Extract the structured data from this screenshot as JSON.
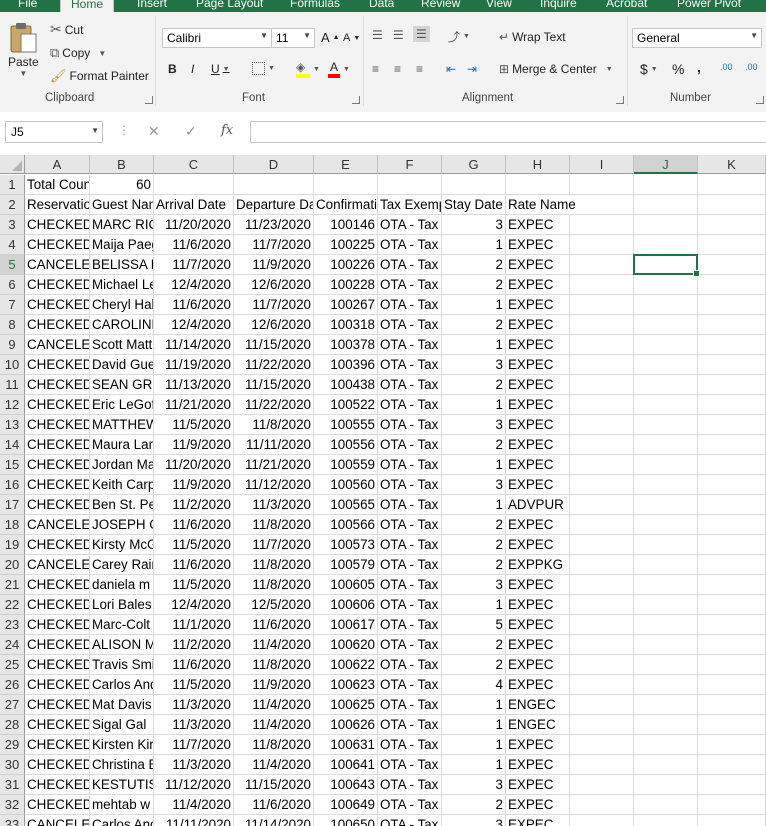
{
  "menu_tabs": [
    "File",
    "Home",
    "Insert",
    "Page Layout",
    "Formulas",
    "Data",
    "Review",
    "View",
    "Inquire",
    "Acrobat",
    "Power Pivot"
  ],
  "active_tab": "Home",
  "ribbon": {
    "clipboard": {
      "paste": "Paste",
      "cut": "Cut",
      "copy": "Copy",
      "format_painter": "Format Painter",
      "label": "Clipboard"
    },
    "font": {
      "name": "Calibri",
      "size": "11",
      "bold": "B",
      "italic": "I",
      "underline": "U",
      "grow": "A",
      "shrink": "A",
      "font_color_glyph": "A",
      "label": "Font"
    },
    "alignment": {
      "wrap_text": "Wrap Text",
      "merge_center": "Merge & Center",
      "label": "Alignment"
    },
    "number": {
      "format": "General",
      "currency": "$",
      "percent": "%",
      "comma": ",",
      "inc_decimal": ".00",
      "dec_decimal": ".00",
      "label": "Number"
    }
  },
  "formula_bar": {
    "name_box": "J5",
    "fx": "fx",
    "formula": ""
  },
  "sheet": {
    "columns": [
      "A",
      "B",
      "C",
      "D",
      "E",
      "F",
      "G",
      "H",
      "I",
      "J",
      "K"
    ],
    "selected_column": "J",
    "selected_row": 5,
    "rows": [
      {
        "n": 1,
        "A": "Total Count",
        "B": "60"
      },
      {
        "n": 2,
        "A": "ReservationStatus",
        "B": "Guest Name",
        "C": "Arrival Date",
        "D": "Departure Date",
        "E": "Confirmation",
        "F": "Tax Exempt",
        "G": "Stay Date",
        "H": "Rate Name"
      },
      {
        "n": 3,
        "A": "CHECKEDOUT",
        "B": "MARC RICH",
        "C": "11/20/2020",
        "D": "11/23/2020",
        "E": "100146",
        "F": "OTA - Tax",
        "G": "3",
        "H": "EXPEC"
      },
      {
        "n": 4,
        "A": "CHECKEDOUT",
        "B": "Maija Paeg",
        "C": "11/6/2020",
        "D": "11/7/2020",
        "E": "100225",
        "F": "OTA - Tax",
        "G": "1",
        "H": "EXPEC"
      },
      {
        "n": 5,
        "A": "CANCELED",
        "B": "BELISSA RO",
        "C": "11/7/2020",
        "D": "11/9/2020",
        "E": "100226",
        "F": "OTA - Tax",
        "G": "2",
        "H": "EXPEC"
      },
      {
        "n": 6,
        "A": "CHECKEDOUT",
        "B": "Michael Le",
        "C": "12/4/2020",
        "D": "12/6/2020",
        "E": "100228",
        "F": "OTA - Tax",
        "G": "2",
        "H": "EXPEC"
      },
      {
        "n": 7,
        "A": "CHECKEDOUT",
        "B": "Cheryl Hal",
        "C": "11/6/2020",
        "D": "11/7/2020",
        "E": "100267",
        "F": "OTA - Tax",
        "G": "1",
        "H": "EXPEC"
      },
      {
        "n": 8,
        "A": "CHECKEDOUT",
        "B": "CAROLINE",
        "C": "12/4/2020",
        "D": "12/6/2020",
        "E": "100318",
        "F": "OTA - Tax",
        "G": "2",
        "H": "EXPEC"
      },
      {
        "n": 9,
        "A": "CANCELED",
        "B": "Scott Matt",
        "C": "11/14/2020",
        "D": "11/15/2020",
        "E": "100378",
        "F": "OTA - Tax",
        "G": "1",
        "H": "EXPEC"
      },
      {
        "n": 10,
        "A": "CHECKEDOUT",
        "B": "David Gue",
        "C": "11/19/2020",
        "D": "11/22/2020",
        "E": "100396",
        "F": "OTA - Tax",
        "G": "3",
        "H": "EXPEC"
      },
      {
        "n": 11,
        "A": "CHECKEDOUT",
        "B": "SEAN GRE",
        "C": "11/13/2020",
        "D": "11/15/2020",
        "E": "100438",
        "F": "OTA - Tax",
        "G": "2",
        "H": "EXPEC"
      },
      {
        "n": 12,
        "A": "CHECKEDOUT",
        "B": "Eric LeGof",
        "C": "11/21/2020",
        "D": "11/22/2020",
        "E": "100522",
        "F": "OTA - Tax",
        "G": "1",
        "H": "EXPEC"
      },
      {
        "n": 13,
        "A": "CHECKEDOUT",
        "B": "MATTHEW",
        "C": "11/5/2020",
        "D": "11/8/2020",
        "E": "100555",
        "F": "OTA - Tax",
        "G": "3",
        "H": "EXPEC"
      },
      {
        "n": 14,
        "A": "CHECKEDOUT",
        "B": "Maura Lar",
        "C": "11/9/2020",
        "D": "11/11/2020",
        "E": "100556",
        "F": "OTA - Tax",
        "G": "2",
        "H": "EXPEC"
      },
      {
        "n": 15,
        "A": "CHECKEDOUT",
        "B": "Jordan Ma",
        "C": "11/20/2020",
        "D": "11/21/2020",
        "E": "100559",
        "F": "OTA - Tax",
        "G": "1",
        "H": "EXPEC"
      },
      {
        "n": 16,
        "A": "CHECKEDOUT",
        "B": "Keith Carp",
        "C": "11/9/2020",
        "D": "11/12/2020",
        "E": "100560",
        "F": "OTA - Tax",
        "G": "3",
        "H": "EXPEC"
      },
      {
        "n": 17,
        "A": "CHECKEDOUT",
        "B": "Ben St. Pe",
        "C": "11/2/2020",
        "D": "11/3/2020",
        "E": "100565",
        "F": "OTA - Tax",
        "G": "1",
        "H": "ADVPUR"
      },
      {
        "n": 18,
        "A": "CANCELED",
        "B": "JOSEPH GO",
        "C": "11/6/2020",
        "D": "11/8/2020",
        "E": "100566",
        "F": "OTA - Tax",
        "G": "2",
        "H": "EXPEC"
      },
      {
        "n": 19,
        "A": "CHECKEDOUT",
        "B": "Kirsty McG",
        "C": "11/5/2020",
        "D": "11/7/2020",
        "E": "100573",
        "F": "OTA - Tax",
        "G": "2",
        "H": "EXPEC"
      },
      {
        "n": 20,
        "A": "CANCELED",
        "B": "Carey Rain",
        "C": "11/6/2020",
        "D": "11/8/2020",
        "E": "100579",
        "F": "OTA - Tax",
        "G": "2",
        "H": "EXPPKG"
      },
      {
        "n": 21,
        "A": "CHECKEDOUT",
        "B": "daniela m",
        "C": "11/5/2020",
        "D": "11/8/2020",
        "E": "100605",
        "F": "OTA - Tax",
        "G": "3",
        "H": "EXPEC"
      },
      {
        "n": 22,
        "A": "CHECKEDOUT",
        "B": "Lori Bales",
        "C": "12/4/2020",
        "D": "12/5/2020",
        "E": "100606",
        "F": "OTA - Tax",
        "G": "1",
        "H": "EXPEC"
      },
      {
        "n": 23,
        "A": "CHECKEDOUT",
        "B": "Marc-Colt",
        "C": "11/1/2020",
        "D": "11/6/2020",
        "E": "100617",
        "F": "OTA - Tax",
        "G": "5",
        "H": "EXPEC"
      },
      {
        "n": 24,
        "A": "CHECKEDOUT",
        "B": "ALISON M",
        "C": "11/2/2020",
        "D": "11/4/2020",
        "E": "100620",
        "F": "OTA - Tax",
        "G": "2",
        "H": "EXPEC"
      },
      {
        "n": 25,
        "A": "CHECKEDOUT",
        "B": "Travis Smi",
        "C": "11/6/2020",
        "D": "11/8/2020",
        "E": "100622",
        "F": "OTA - Tax",
        "G": "2",
        "H": "EXPEC"
      },
      {
        "n": 26,
        "A": "CHECKEDOUT",
        "B": "Carlos And",
        "C": "11/5/2020",
        "D": "11/9/2020",
        "E": "100623",
        "F": "OTA - Tax",
        "G": "4",
        "H": "EXPEC"
      },
      {
        "n": 27,
        "A": "CHECKEDOUT",
        "B": "Mat Davis",
        "C": "11/3/2020",
        "D": "11/4/2020",
        "E": "100625",
        "F": "OTA - Tax",
        "G": "1",
        "H": "ENGEC"
      },
      {
        "n": 28,
        "A": "CHECKEDOUT",
        "B": "Sigal Gal",
        "C": "11/3/2020",
        "D": "11/4/2020",
        "E": "100626",
        "F": "OTA - Tax",
        "G": "1",
        "H": "ENGEC"
      },
      {
        "n": 29,
        "A": "CHECKEDOUT",
        "B": "Kirsten Kir",
        "C": "11/7/2020",
        "D": "11/8/2020",
        "E": "100631",
        "F": "OTA - Tax",
        "G": "1",
        "H": "EXPEC"
      },
      {
        "n": 30,
        "A": "CHECKEDOUT",
        "B": "Christina B",
        "C": "11/3/2020",
        "D": "11/4/2020",
        "E": "100641",
        "F": "OTA - Tax",
        "G": "1",
        "H": "EXPEC"
      },
      {
        "n": 31,
        "A": "CHECKEDOUT",
        "B": "KESTUTIS K",
        "C": "11/12/2020",
        "D": "11/15/2020",
        "E": "100643",
        "F": "OTA - Tax",
        "G": "3",
        "H": "EXPEC"
      },
      {
        "n": 32,
        "A": "CHECKEDOUT",
        "B": "mehtab w",
        "C": "11/4/2020",
        "D": "11/6/2020",
        "E": "100649",
        "F": "OTA - Tax",
        "G": "2",
        "H": "EXPEC"
      },
      {
        "n": 33,
        "A": "CANCELED",
        "B": "Carlos And",
        "C": "11/11/2020",
        "D": "11/14/2020",
        "E": "100650",
        "F": "OTA - Tax",
        "G": "3",
        "H": "EXPEC"
      }
    ]
  }
}
